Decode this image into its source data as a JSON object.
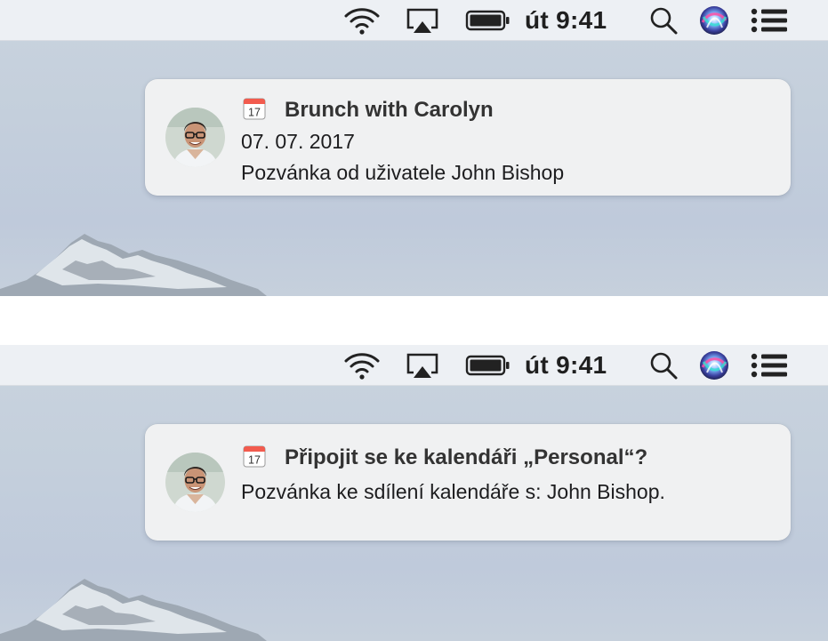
{
  "menubar": {
    "clock": "út 9:41",
    "icons": [
      "wifi-icon",
      "airplay-icon",
      "battery-icon",
      "search-icon",
      "siri-icon",
      "notification-center-icon"
    ]
  },
  "notifications": [
    {
      "app_icon": "calendar-icon",
      "calendar_day": "17",
      "title": "Brunch with Carolyn",
      "date": "07. 07. 2017",
      "body": "Pozvánka od uživatele John Bishop"
    },
    {
      "app_icon": "calendar-icon",
      "calendar_day": "17",
      "title": "Připojit se ke kalendáři „Personal“?",
      "body": "Pozvánka ke sdílení kalendáře s: John Bishop."
    }
  ]
}
